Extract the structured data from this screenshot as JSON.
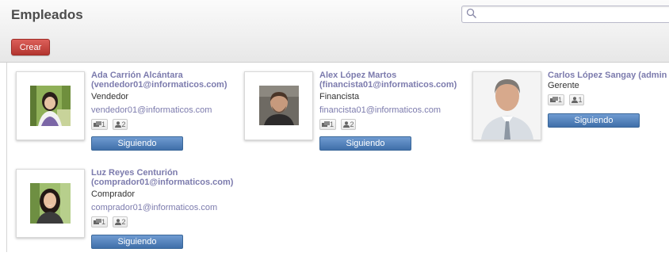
{
  "header": {
    "title": "Empleados",
    "search_placeholder": "",
    "create_label": "Crear"
  },
  "employees": [
    {
      "name": "Ada Carrión Alcántara",
      "email_paren": "(vendedor01@informaticos.com)",
      "job": "Vendedor",
      "email": "vendedor01@informaticos.com",
      "messages_count": "1",
      "followers_count": "2",
      "follow_label": "Siguiendo"
    },
    {
      "name": "Alex López Martos",
      "email_paren": "(financista01@informaticos.com)",
      "job": "Financista",
      "email": "financista01@informaticos.com",
      "messages_count": "1",
      "followers_count": "2",
      "follow_label": "Siguiendo"
    },
    {
      "name": "Carlos López Sangay (admin",
      "job": "Gerente",
      "messages_count": "1",
      "followers_count": "1",
      "follow_label": "Siguiendo"
    },
    {
      "name": "Luz Reyes Centurión",
      "email_paren": "(comprador01@informaticos.com)",
      "job": "Comprador",
      "email": "comprador01@informaticos.com",
      "messages_count": "1",
      "followers_count": "2",
      "follow_label": "Siguiendo"
    }
  ]
}
